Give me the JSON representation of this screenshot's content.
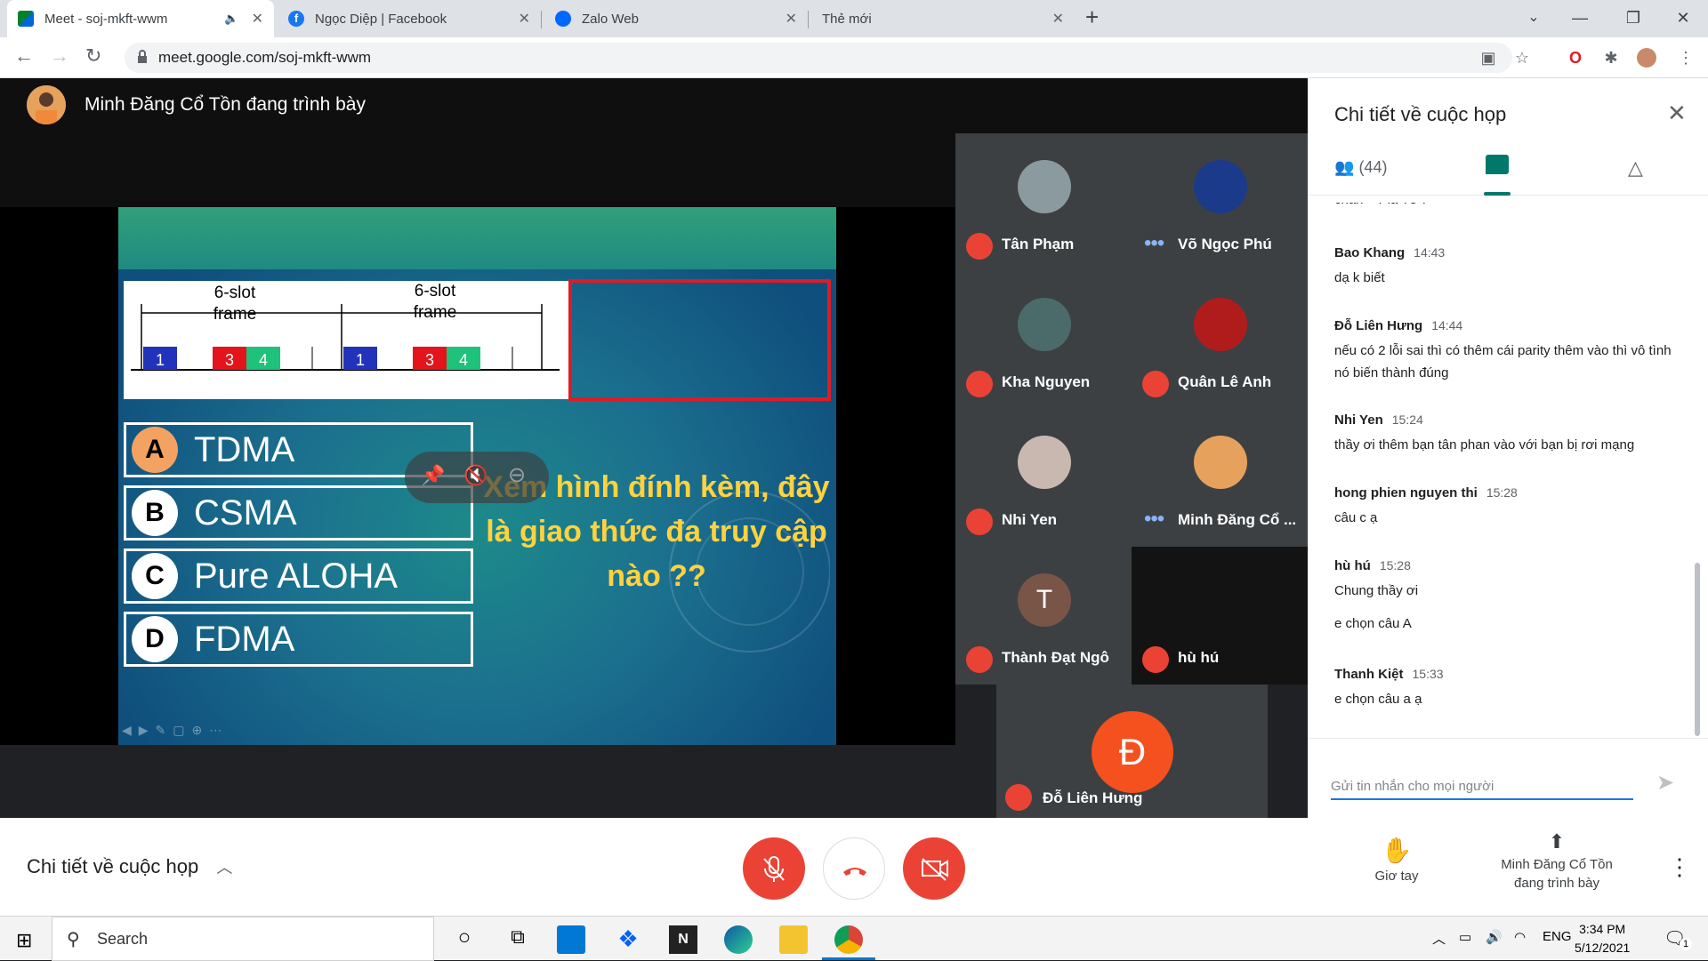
{
  "browser": {
    "tabs": [
      {
        "title": "Meet - soj-mkft-wwm",
        "active": true
      },
      {
        "title": "Ngọc Diệp | Facebook",
        "active": false
      },
      {
        "title": "Zalo Web",
        "active": false
      },
      {
        "title": "Thẻ mới",
        "active": false
      }
    ],
    "url": "meet.google.com/soj-mkft-wwm"
  },
  "presentation": {
    "presenter_label": "Minh Đăng Cổ Tồn đang trình bày",
    "slide": {
      "frame_label_1": "6-slot frame",
      "frame_label_2": "6-slot frame",
      "choices": [
        {
          "letter": "A",
          "text": "TDMA"
        },
        {
          "letter": "B",
          "text": "CSMA"
        },
        {
          "letter": "C",
          "text": "Pure ALOHA"
        },
        {
          "letter": "D",
          "text": "FDMA"
        }
      ],
      "question": "Xem hình đính kèm, đây là giao thức đa truy cập nào ??"
    }
  },
  "participants": [
    {
      "name": "Tân Phạm",
      "status": "muted"
    },
    {
      "name": "Võ Ngọc Phú",
      "status": "speaking"
    },
    {
      "name": "Kha Nguyen",
      "status": "muted"
    },
    {
      "name": "Quân Lê Anh",
      "status": "muted"
    },
    {
      "name": "Nhi Yen",
      "status": "muted"
    },
    {
      "name": "Minh Đăng Cổ ...",
      "status": "speaking"
    },
    {
      "name": "Thành Đạt Ngô",
      "status": "muted",
      "initial": "T"
    },
    {
      "name": "hù hú",
      "status": "muted"
    },
    {
      "name": "Đỗ Liên Hưng",
      "status": "muted",
      "initial": "Đ"
    }
  ],
  "sidepanel": {
    "title": "Chi tiết về cuộc họp",
    "people_count": "(44)",
    "partial_msg": "chắn + Pla Tê ?",
    "messages": [
      {
        "sender": "Bao Khang",
        "time": "14:43",
        "lines": [
          "dạ k biết"
        ]
      },
      {
        "sender": "Đỗ Liên Hưng",
        "time": "14:44",
        "lines": [
          "nếu có 2 lỗi sai thì có thêm cái parity thêm vào thì vô tình nó biến thành đúng"
        ]
      },
      {
        "sender": "Nhi Yen",
        "time": "15:24",
        "lines": [
          "thầy ơi thêm bạn tân phan vào với bạn bị rơi mạng"
        ]
      },
      {
        "sender": "hong phien nguyen thi",
        "time": "15:28",
        "lines": [
          "câu c ạ"
        ]
      },
      {
        "sender": "hù hú",
        "time": "15:28",
        "lines": [
          "Chung thầy ơi",
          "e chọn câu A"
        ]
      },
      {
        "sender": "Thanh Kiệt",
        "time": "15:33",
        "lines": [
          "e chọn câu a ạ"
        ]
      }
    ],
    "input_placeholder": "Gửi tin nhắn cho mọi người"
  },
  "controls": {
    "details_label": "Chi tiết về cuộc họp",
    "raise_hand": "Giơ tay",
    "presenting_line1": "Minh Đăng Cổ Tồn",
    "presenting_line2": "đang trình bày"
  },
  "taskbar": {
    "search": "Search",
    "lang": "ENG",
    "time": "3:34 PM",
    "date": "5/12/2021",
    "notif": "1"
  },
  "colors": {
    "red": "#ea4335",
    "meet_dark": "#202124",
    "accent": "#1a73e8",
    "chat_green": "#00796b"
  }
}
